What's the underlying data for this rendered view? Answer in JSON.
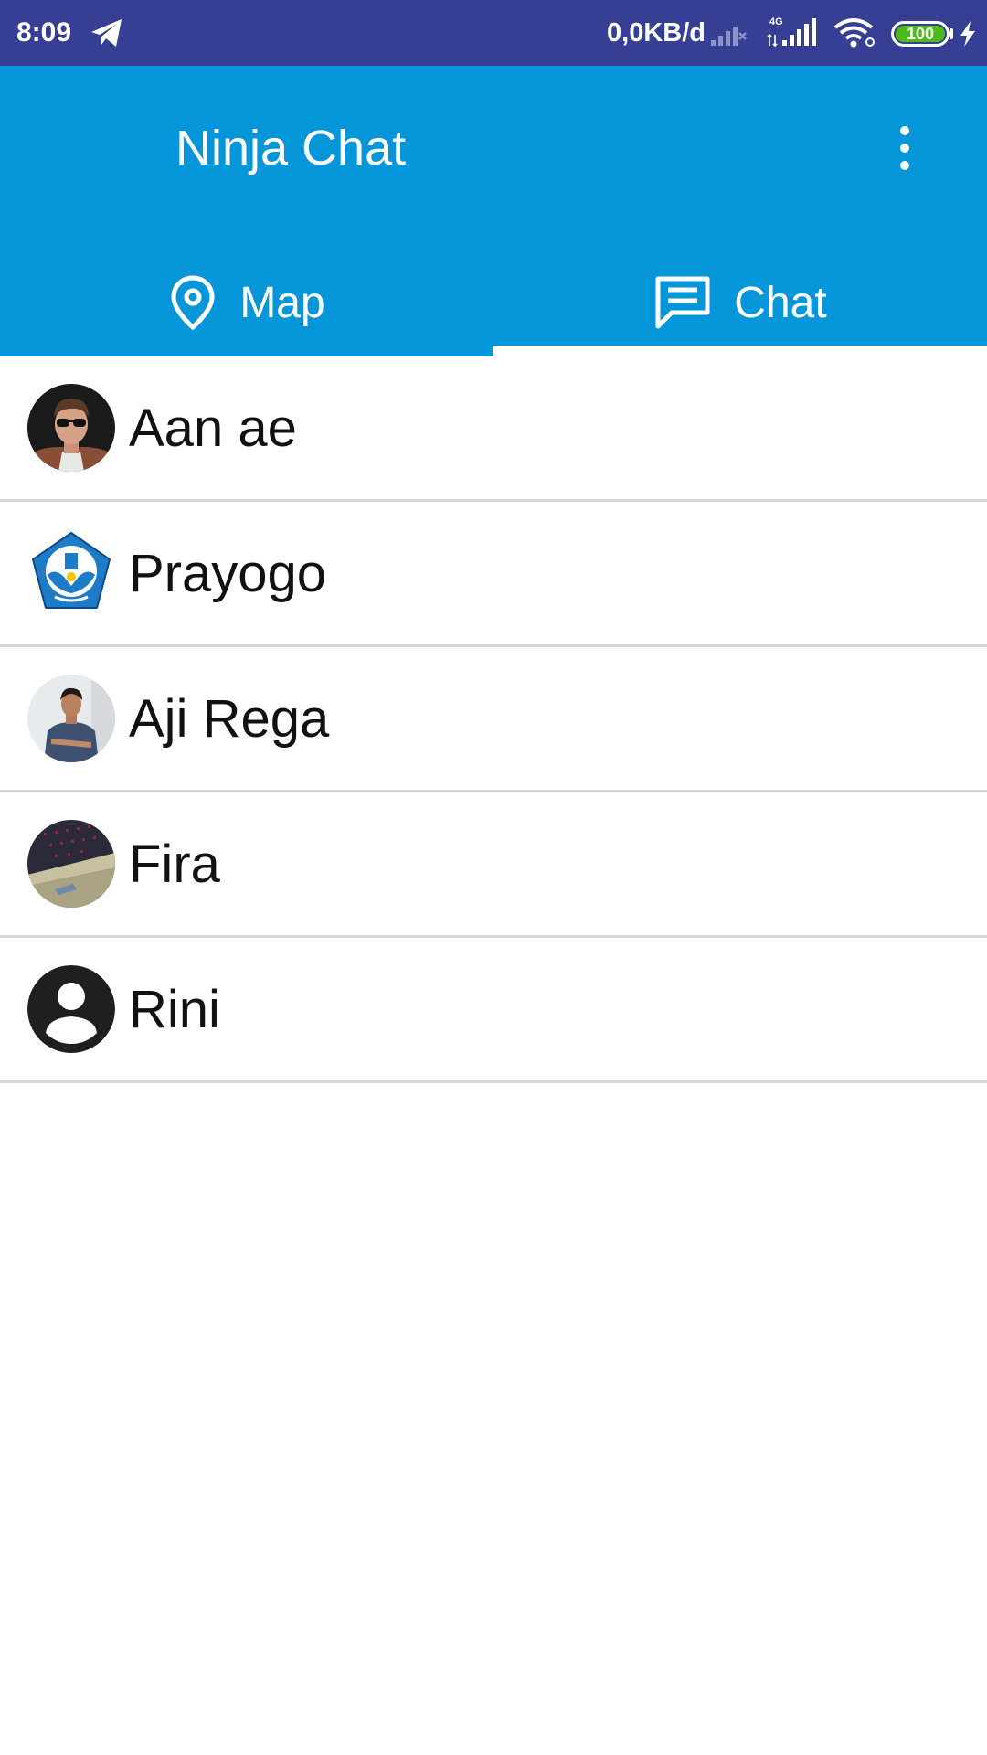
{
  "status_bar": {
    "time": "8:09",
    "data_rate": "0,0KB/d",
    "network_type": "4G",
    "battery_level": "100",
    "icons": [
      "telegram-icon",
      "signal-weak-icon",
      "signal-4g-icon",
      "wifi-icon",
      "battery-icon",
      "charging-icon"
    ]
  },
  "app_bar": {
    "title": "Ninja Chat",
    "menu_icon": "more-vert-icon",
    "color": "#0496d8"
  },
  "tabs": [
    {
      "label": "Map",
      "icon": "map-pin-icon",
      "selected": false
    },
    {
      "label": "Chat",
      "icon": "chat-icon",
      "selected": true
    }
  ],
  "contacts": [
    {
      "name": "Aan ae",
      "avatar": "photo-man-sunglasses"
    },
    {
      "name": "Prayogo",
      "avatar": "emblem-logo"
    },
    {
      "name": "Aji Rega",
      "avatar": "photo-man-standing"
    },
    {
      "name": "Fira",
      "avatar": "photo-ceiling"
    },
    {
      "name": "Rini",
      "avatar": "default-person-icon"
    }
  ],
  "colors": {
    "status_bar": "#363f93",
    "accent": "#0496d8",
    "battery": "#4cbb17",
    "divider": "#d6d6d6"
  }
}
